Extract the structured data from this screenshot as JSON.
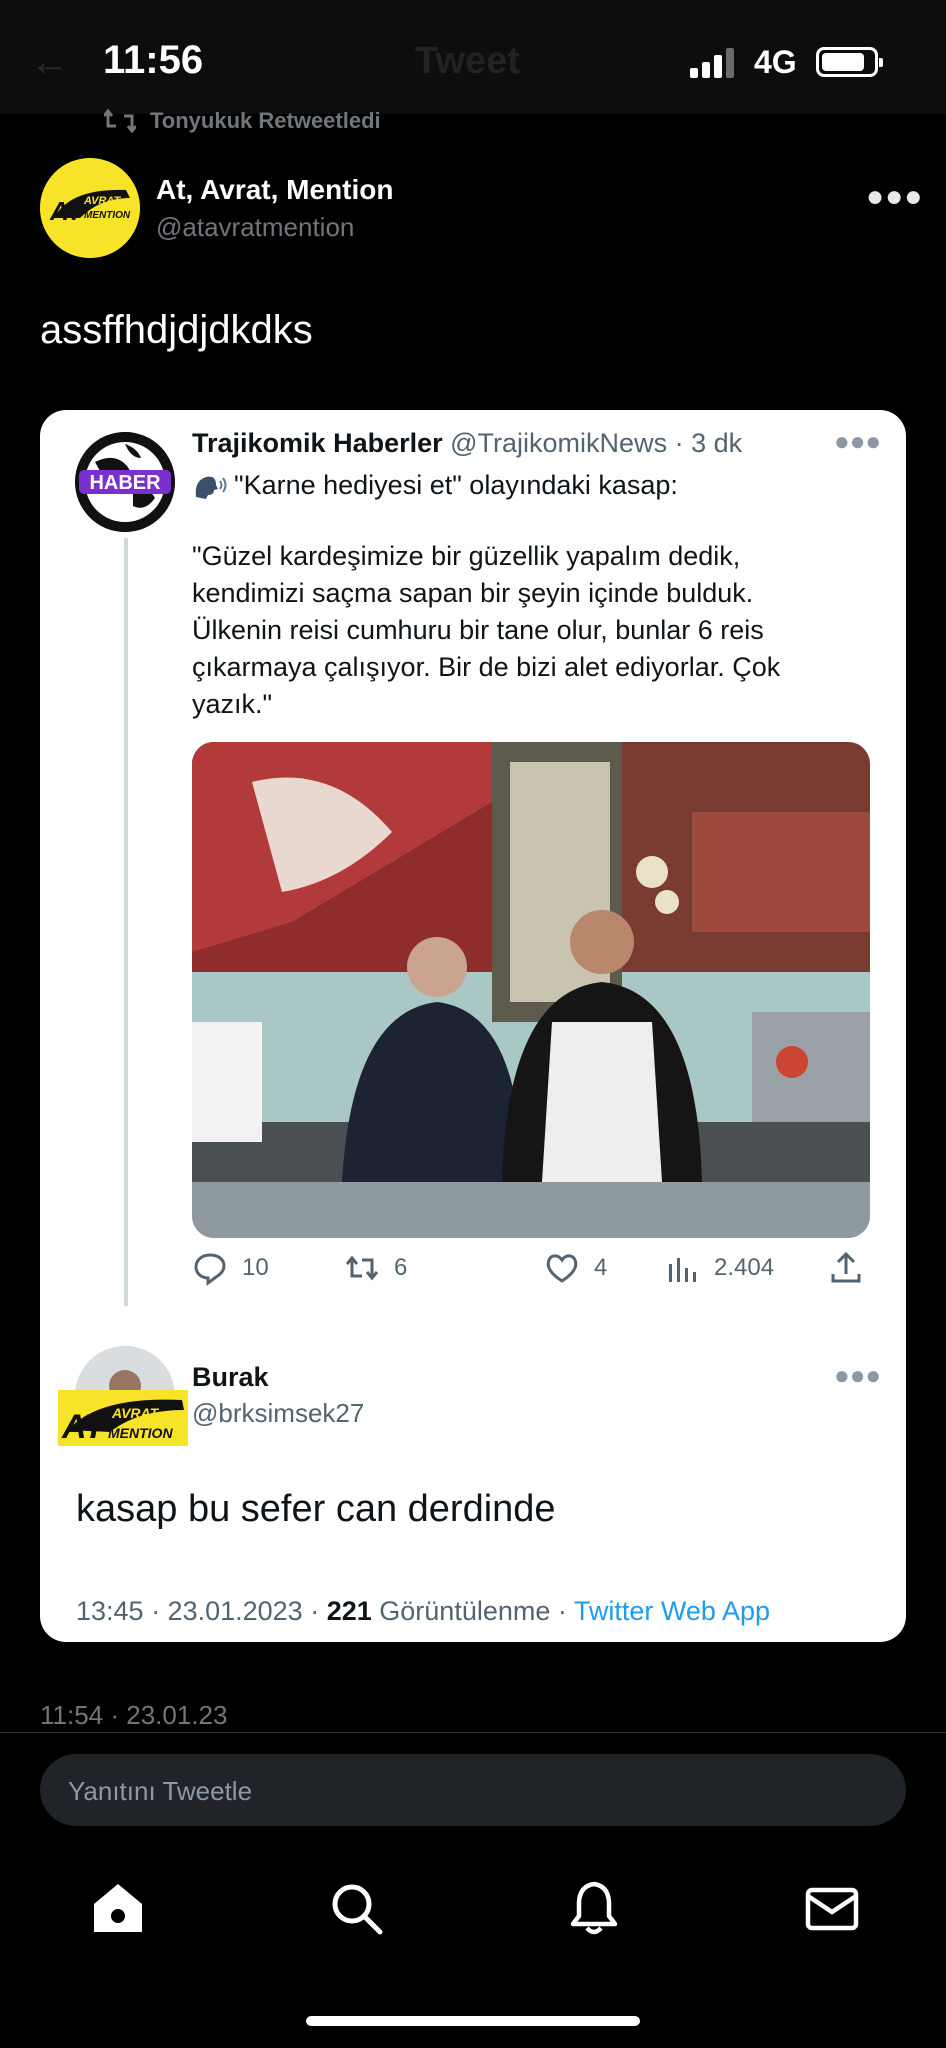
{
  "status_bar": {
    "time": "11:56",
    "network": "4G",
    "ghost_title": "Tweet"
  },
  "retweet": {
    "label": "Tonyukuk Retweetledi"
  },
  "author": {
    "name": "At, Avrat, Mention",
    "handle": "@atavratmention",
    "avatar_text_top": "AVRAT",
    "avatar_text_main": "AT",
    "avatar_text_bottom": "MENTION"
  },
  "tweet": {
    "text": "assffhdjdjdkdks",
    "timestamp": "11:54 · 23.01.23"
  },
  "quoted": {
    "name": "Trajikomik Haberler",
    "handle": "@TrajikomikNews",
    "age": "· 3 dk",
    "avatar_text": "HABER",
    "headline": "\"Karne hediyesi et\" olayındaki kasap:",
    "body": "\"Güzel kardeşimize bir güzellik yapalım dedik,\nkendimizi saçma sapan bir şeyin içinde bulduk.\nÜlkenin reisi cumhuru bir tane olur, bunlar 6 reis\nçıkarmaya çalışıyor. Bir de bizi alet ediyorlar. Çok\nyazık.\"",
    "stats": {
      "replies": "10",
      "retweets": "6",
      "likes": "4",
      "views": "2.404"
    }
  },
  "reply": {
    "name": "Burak",
    "handle": "@brksimsek27",
    "text": "kasap bu sefer can derdinde",
    "time_date": "13:45 · 23.01.2023 ·",
    "views_count": "221",
    "views_label": "Görüntülenme ·",
    "source": "Twitter Web App"
  },
  "reply_box": {
    "placeholder": "Yanıtını Tweetle"
  },
  "colors": {
    "background": "#000000",
    "card": "#ffffff",
    "link": "#1d9bf0",
    "secondary_text": "#71767b",
    "brand_yellow": "#f7e327"
  },
  "tabs": [
    "home-icon",
    "search-icon",
    "bell-icon",
    "mail-icon"
  ]
}
